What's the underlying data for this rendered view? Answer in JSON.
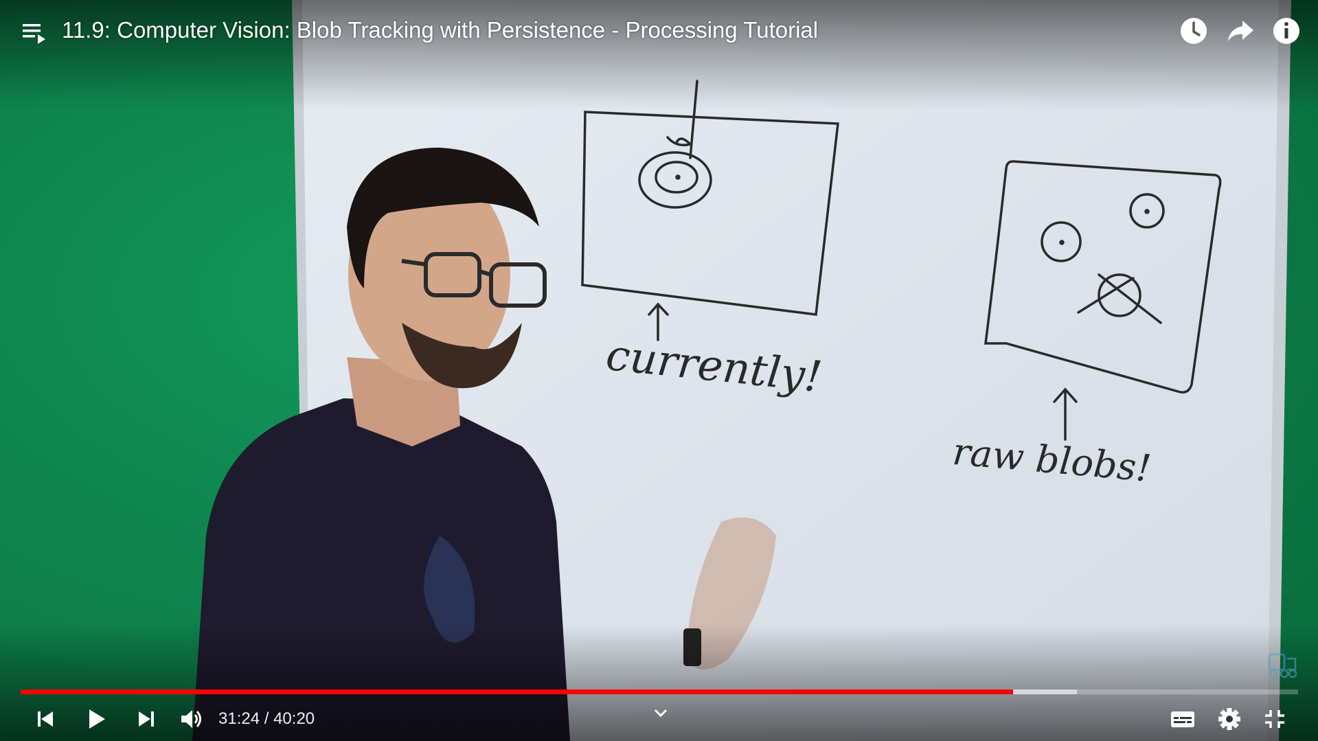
{
  "video": {
    "title": "11.9: Computer Vision: Blob Tracking with Persistence - Processing Tutorial",
    "current_time": "31:24",
    "time_separator": " / ",
    "duration": "40:20",
    "progress_fraction": 0.777,
    "buffered_fraction": 0.827
  },
  "whiteboard": {
    "note_left": "currently!",
    "note_right": "raw blobs!"
  },
  "colors": {
    "progress_played": "#ff0000",
    "background_green": "#0f8a4f"
  },
  "icons": {
    "playlist": "playlist-icon",
    "watch_later": "clock-icon",
    "share": "share-arrow-icon",
    "info": "info-icon",
    "previous": "skip-previous-icon",
    "play": "play-icon",
    "next": "skip-next-icon",
    "volume": "volume-icon",
    "subtitles": "subtitles-icon",
    "settings": "gear-icon",
    "exit_fullscreen": "exit-fullscreen-icon"
  }
}
